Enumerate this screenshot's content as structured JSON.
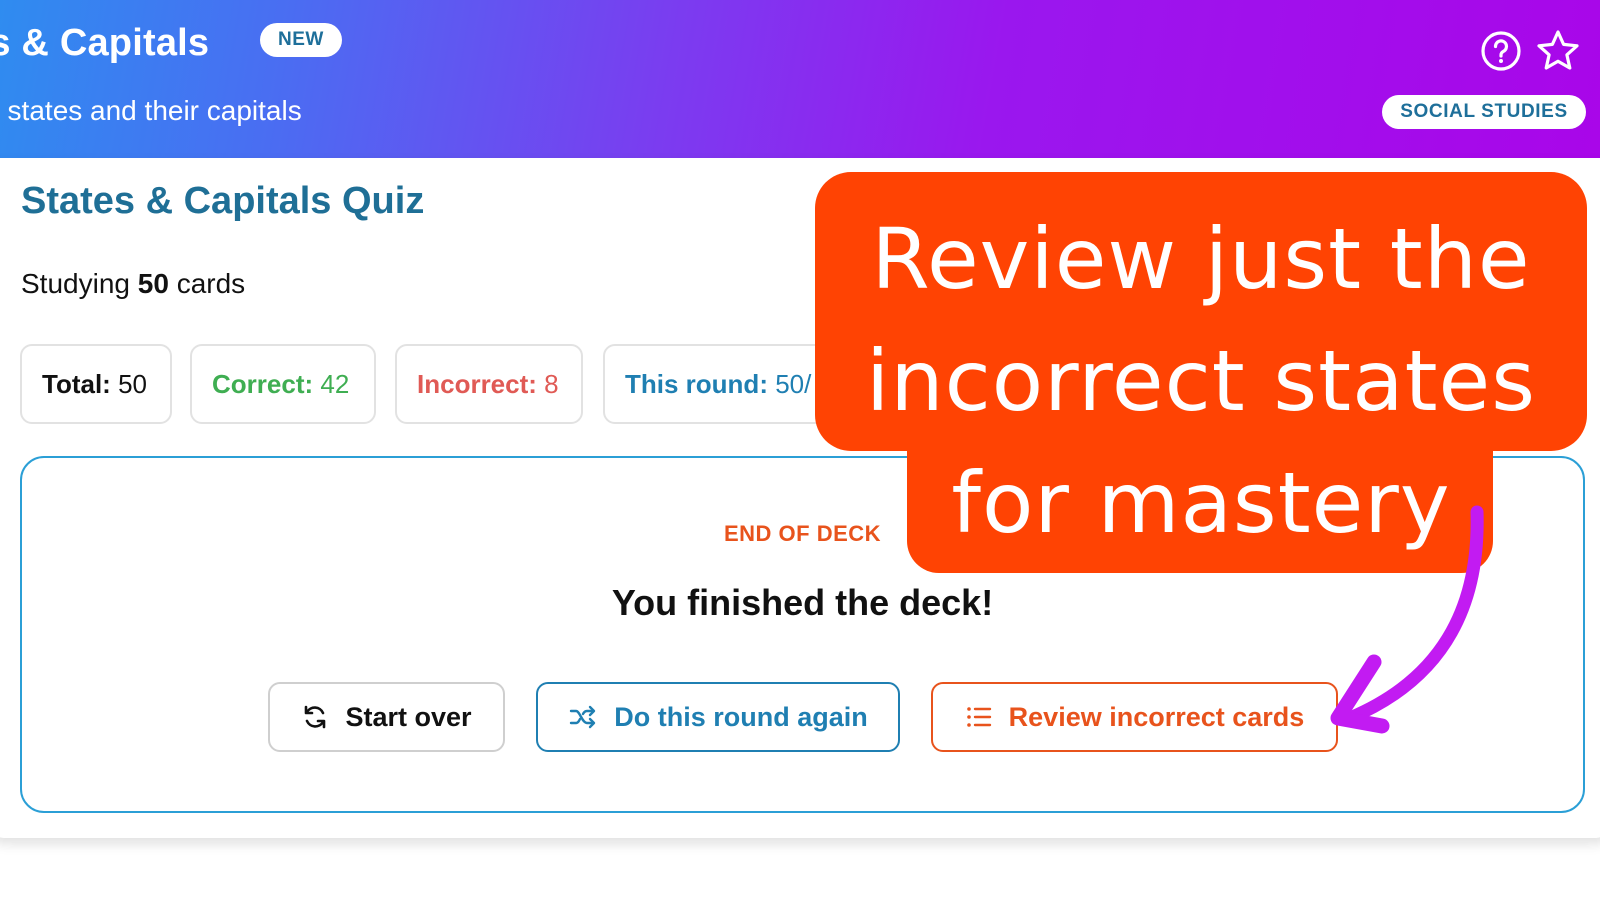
{
  "header": {
    "title": "es & Capitals",
    "new_badge": "NEW",
    "subtitle": ". states and their capitals",
    "subject_badge": "SOCIAL STUDIES",
    "icons": [
      "help-circle-icon",
      "star-outline-icon"
    ]
  },
  "quiz": {
    "title": "States & Capitals Quiz",
    "studying_prefix": "Studying",
    "studying_count": "50",
    "studying_suffix": "cards"
  },
  "stats": {
    "total_label": "Total:",
    "total_value": "50",
    "correct_label": "Correct:",
    "correct_value": "42",
    "incorrect_label": "Incorrect:",
    "incorrect_value": "8",
    "round_label": "This round:",
    "round_value": "50/"
  },
  "end_of_deck": {
    "label": "END OF DECK",
    "heading": "You finished the deck!"
  },
  "actions": {
    "start_over": "Start over",
    "round_again": "Do this round again",
    "review_incorrect": "Review incorrect cards"
  },
  "callout": {
    "line1": "Review just the",
    "line2": "incorrect states",
    "line3": "for mastery"
  },
  "colors": {
    "accent_blue": "#1f7fb2",
    "correct_green": "#3fae52",
    "incorrect_red": "#e05a55",
    "callout_orange": "#ff4303",
    "arrow_purple": "#c21bf2"
  }
}
